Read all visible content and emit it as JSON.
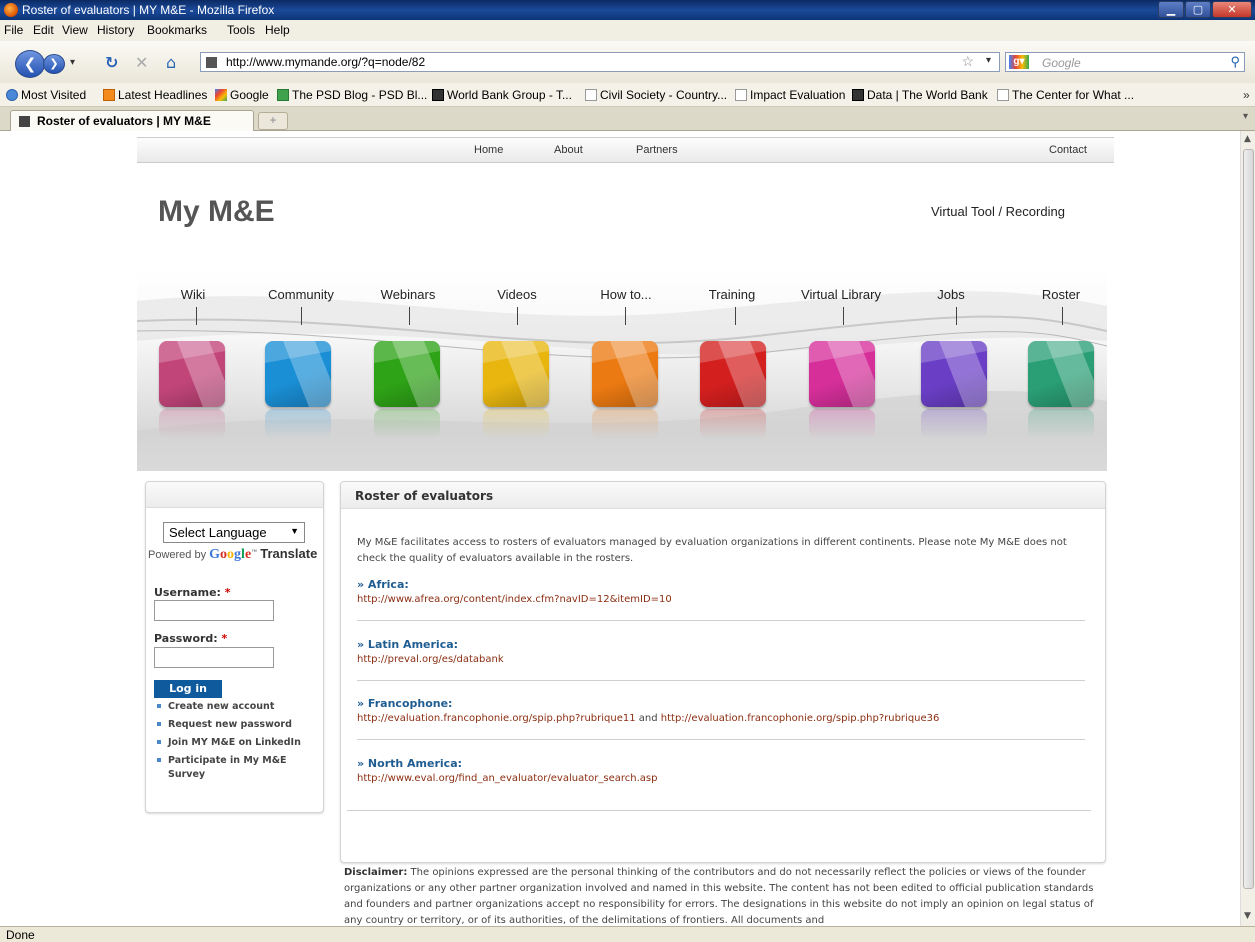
{
  "window": {
    "title": "Roster of evaluators | MY M&E - Mozilla Firefox"
  },
  "menu": [
    "File",
    "Edit",
    "View",
    "History",
    "Bookmarks",
    "Tools",
    "Help"
  ],
  "address": {
    "url": "http://www.mymande.org/?q=node/82",
    "search_placeholder": "Google"
  },
  "bookmarks": [
    "Most Visited",
    "Latest Headlines",
    "Google",
    "The PSD Blog - PSD Bl...",
    "World Bank Group - T...",
    "Civil Society - Country...",
    "Impact Evaluation",
    "Data | The World Bank",
    "The Center for What ..."
  ],
  "tab": {
    "title": "Roster of evaluators | MY M&E",
    "new_tab": "+"
  },
  "status": "Done",
  "site": {
    "nav": {
      "home": "Home",
      "about": "About",
      "partners": "Partners",
      "contact": "Contact"
    },
    "logo": "My M&E",
    "tagline": "Virtual Tool / Recording",
    "categories": [
      "Wiki",
      "Community",
      "Webinars",
      "Videos",
      "How to...",
      "Training",
      "Virtual  Library",
      "Jobs",
      "Roster"
    ],
    "cube_colors": [
      "#c2457a",
      "#1a8fd6",
      "#2ea317",
      "#e8b60f",
      "#ec7a12",
      "#d41f1f",
      "#d62f9a",
      "#6a3fc6",
      "#2a9f76"
    ]
  },
  "sidebar": {
    "language": "Select Language",
    "powered_by": "Powered by",
    "google": [
      "G",
      "o",
      "o",
      "g",
      "l",
      "e"
    ],
    "translate": "Translate",
    "username_label": "Username:",
    "password_label": "Password:",
    "required": "*",
    "login": "Log in",
    "links": [
      "Create new account",
      "Request new password",
      "Join MY M&E on LinkedIn",
      "Participate in My M&E Survey"
    ]
  },
  "main": {
    "title": "Roster of evaluators",
    "intro": "My M&E facilitates access to rosters of evaluators managed by evaluation organizations in different continents. Please note My M&E does not check the quality of evaluators available in the rosters.",
    "regions": [
      {
        "title": "» Africa:",
        "link": "http://www.afrea.org/content/index.cfm?navID=12&itemID=10"
      },
      {
        "title": "» Latin America:",
        "link": "http://preval.org/es/databank"
      },
      {
        "title": "» Francophone:",
        "link": "http://evaluation.francophonie.org/spip.php?rubrique11",
        "and": " and ",
        "link2": "http://evaluation.francophonie.org/spip.php?rubrique36"
      },
      {
        "title": "» North America:",
        "link": "http://www.eval.org/find_an_evaluator/evaluator_search.asp"
      }
    ]
  },
  "disclaimer": {
    "label": "Disclaimer:",
    "text": " The opinions expressed are the personal thinking of the contributors and do not necessarily reflect the policies or views of the founder organizations or any other partner organization involved and named in this website. The content has not been edited to official publication standards and founders and partner organizations accept no responsibility for errors. The designations in this website do not imply an opinion on legal status of any country or territory, or of its authorities, of the delimitations of frontiers. All documents and"
  }
}
